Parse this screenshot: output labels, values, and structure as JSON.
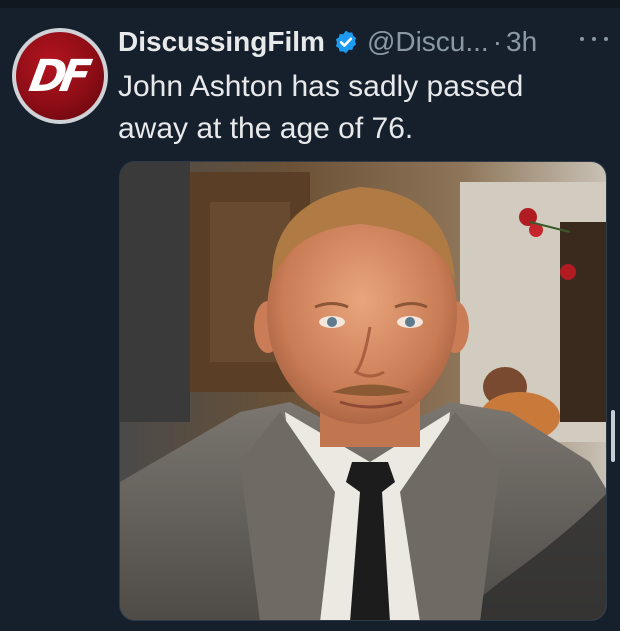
{
  "tweet": {
    "display_name": "DiscussingFilm",
    "handle": "@Discu...",
    "separator": "·",
    "timestamp": "3h",
    "text": "John Ashton has sadly passed away at the age of 76.",
    "verified": true,
    "avatar": {
      "logo_text": "DF",
      "color": "#b3141f"
    },
    "media": {
      "type": "photo"
    }
  },
  "icons": {
    "verified": "verified-badge-icon",
    "more": "more-options-icon"
  },
  "colors": {
    "background": "#16202c",
    "text_primary": "#e7e9ea",
    "text_secondary": "#8b98a5",
    "verified_blue": "#1d9bf0"
  }
}
